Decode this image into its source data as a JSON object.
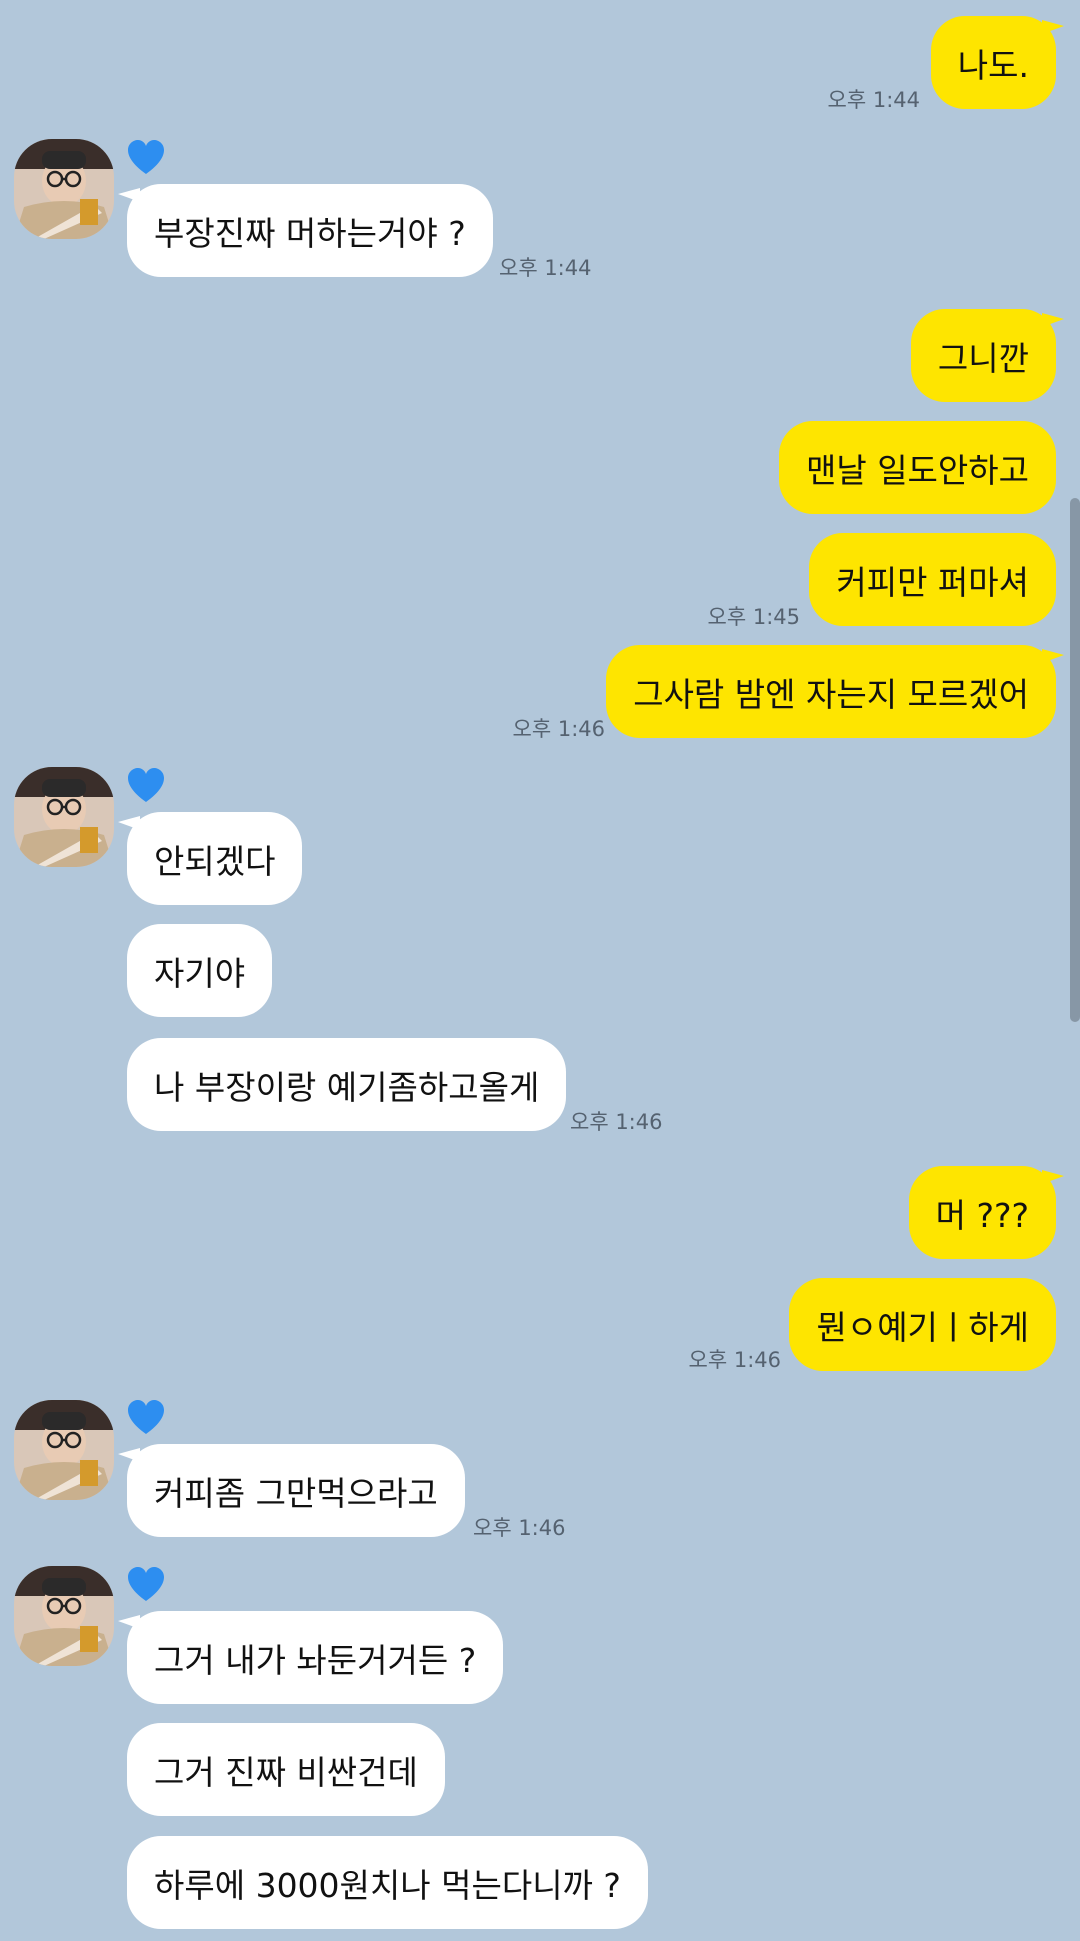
{
  "messages": {
    "m1": {
      "text": "나도.",
      "time": "오후 1:44"
    },
    "m2": {
      "text": "부장진짜 머하는거야 ?",
      "time": "오후 1:44"
    },
    "m3": {
      "text": "그니깐"
    },
    "m4": {
      "text": "맨날 일도안하고"
    },
    "m5": {
      "text": "커피만 퍼마셔",
      "time": "오후 1:45"
    },
    "m6": {
      "text": "그사람 밤엔 자는지 모르겠어",
      "time": "오후 1:46"
    },
    "m7": {
      "text": "안되겠다"
    },
    "m8": {
      "text": "자기야"
    },
    "m9": {
      "text": "나 부장이랑 예기좀하고올게",
      "time": "오후 1:46"
    },
    "m10": {
      "text": "머 ???"
    },
    "m11": {
      "text": "뭔ㅇ예기ㅣ하게",
      "time": "오후 1:46"
    },
    "m12": {
      "text": "커피좀 그만먹으라고",
      "time": "오후 1:46"
    },
    "m13": {
      "text": "그거 내가 놔둔거거든 ?"
    },
    "m14": {
      "text": "그거 진짜 비싼건데"
    },
    "m15": {
      "text": "하루에 3000원치나 먹는다니까 ?"
    }
  },
  "colors": {
    "background": "#b2c7da",
    "my_bubble": "#fee500",
    "their_bubble": "#ffffff",
    "heart": "#2d8ef0"
  },
  "icons": {
    "heart": "blue-heart-icon",
    "avatar": "contact-avatar"
  }
}
